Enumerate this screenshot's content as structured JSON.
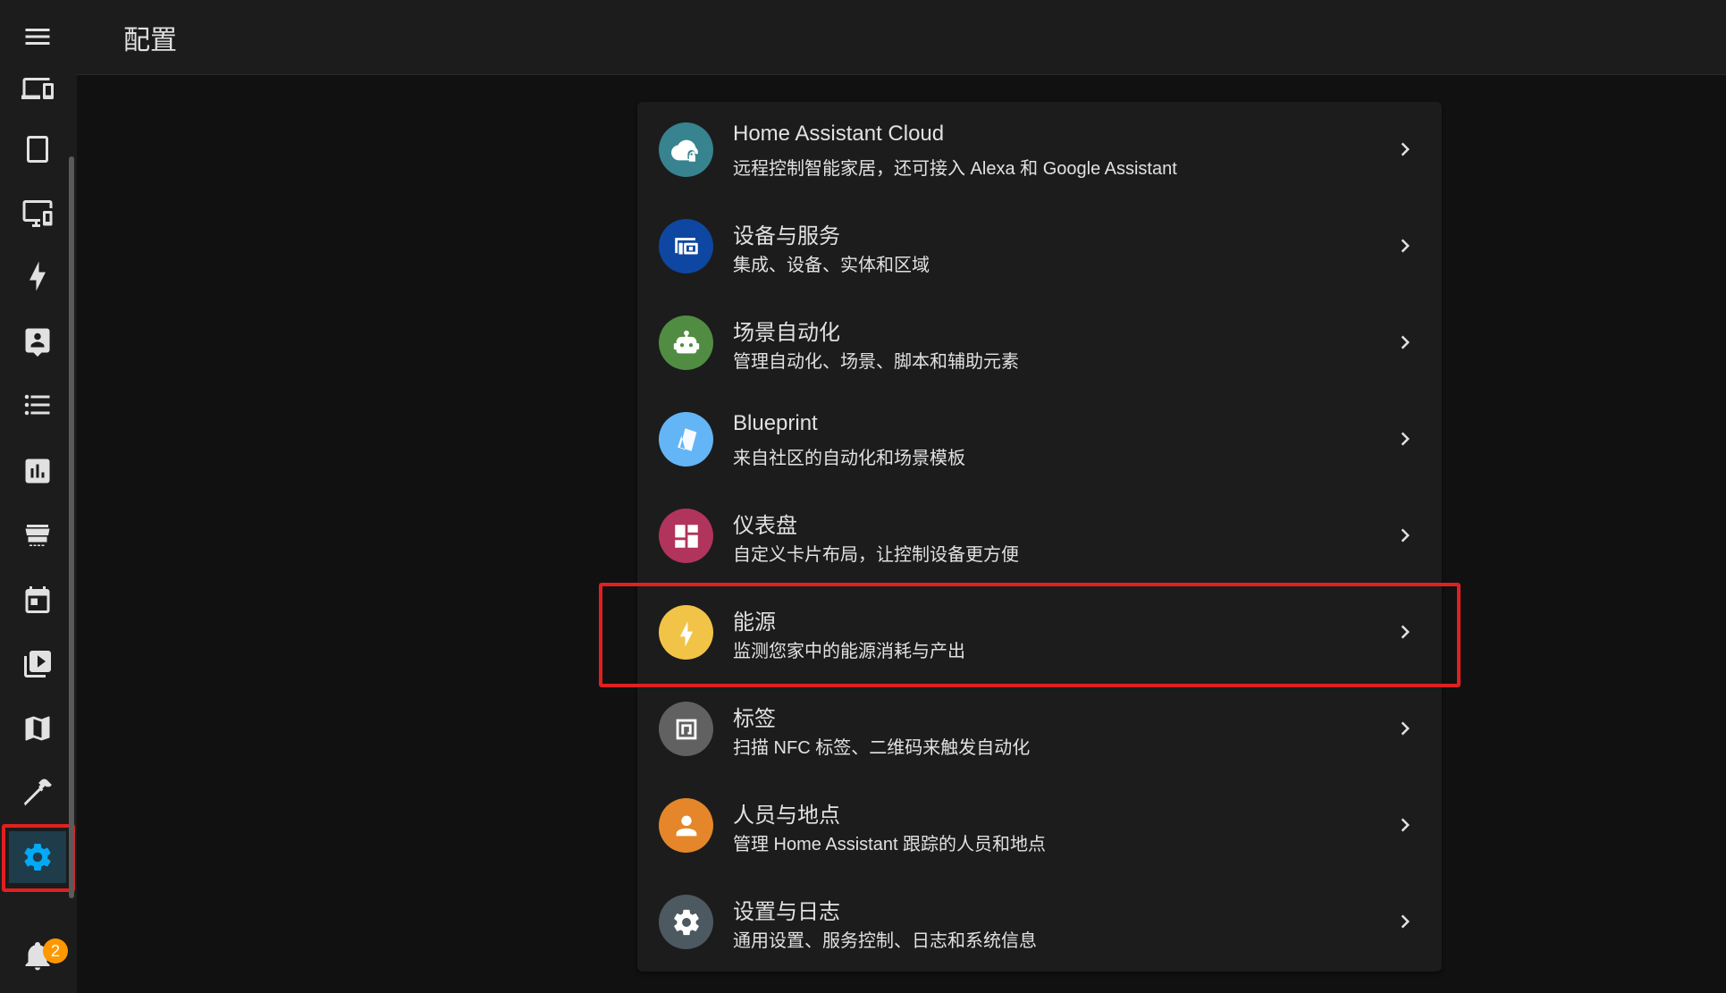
{
  "header": {
    "title": "配置"
  },
  "sidebar": {
    "items": [
      {
        "icon": "menu-icon"
      },
      {
        "icon": "devices-icon"
      },
      {
        "icon": "tablet-icon"
      },
      {
        "icon": "monitor-cellphone-icon"
      },
      {
        "icon": "lightning-bolt-icon"
      },
      {
        "icon": "account-box-icon"
      },
      {
        "icon": "format-list-bulleted-icon"
      },
      {
        "icon": "chart-box-icon"
      },
      {
        "icon": "hacs-store-icon"
      },
      {
        "icon": "calendar-icon"
      },
      {
        "icon": "play-box-multiple-icon"
      },
      {
        "icon": "map-icon"
      },
      {
        "icon": "hammer-icon"
      },
      {
        "icon": "cog-icon"
      },
      {
        "icon": "bell-icon"
      }
    ],
    "notification_count": "2"
  },
  "config_items": [
    {
      "name": "Home Assistant Cloud",
      "desc": "远程控制智能家居，还可接入 Alexa 和 Google Assistant",
      "color": "#37838f",
      "icon": "cloud-lock-icon"
    },
    {
      "name": "设备与服务",
      "desc": "集成、设备、实体和区域",
      "color": "#0d47a1",
      "icon": "devices-icon"
    },
    {
      "name": "场景自动化",
      "desc": "管理自动化、场景、脚本和辅助元素",
      "color": "#518c43",
      "icon": "robot-icon"
    },
    {
      "name": "Blueprint",
      "desc": "来自社区的自动化和场景模板",
      "color": "#64b5f6",
      "icon": "paper-cut-icon"
    },
    {
      "name": "仪表盘",
      "desc": "自定义卡片布局，让控制设备更方便",
      "color": "#b1345c",
      "icon": "view-dashboard-icon"
    },
    {
      "name": "能源",
      "desc": "监测您家中的能源消耗与产出",
      "color": "#f1c447",
      "icon": "lightning-bolt-icon"
    },
    {
      "name": "标签",
      "desc": "扫描 NFC 标签、二维码来触发自动化",
      "color": "#616161",
      "icon": "nfc-tag-icon"
    },
    {
      "name": "人员与地点",
      "desc": "管理 Home Assistant 跟踪的人员和地点",
      "color": "#e48629",
      "icon": "account-icon"
    },
    {
      "name": "设置与日志",
      "desc": "通用设置、服务控制、日志和系统信息",
      "color": "#4c5961",
      "icon": "cog-icon"
    }
  ]
}
